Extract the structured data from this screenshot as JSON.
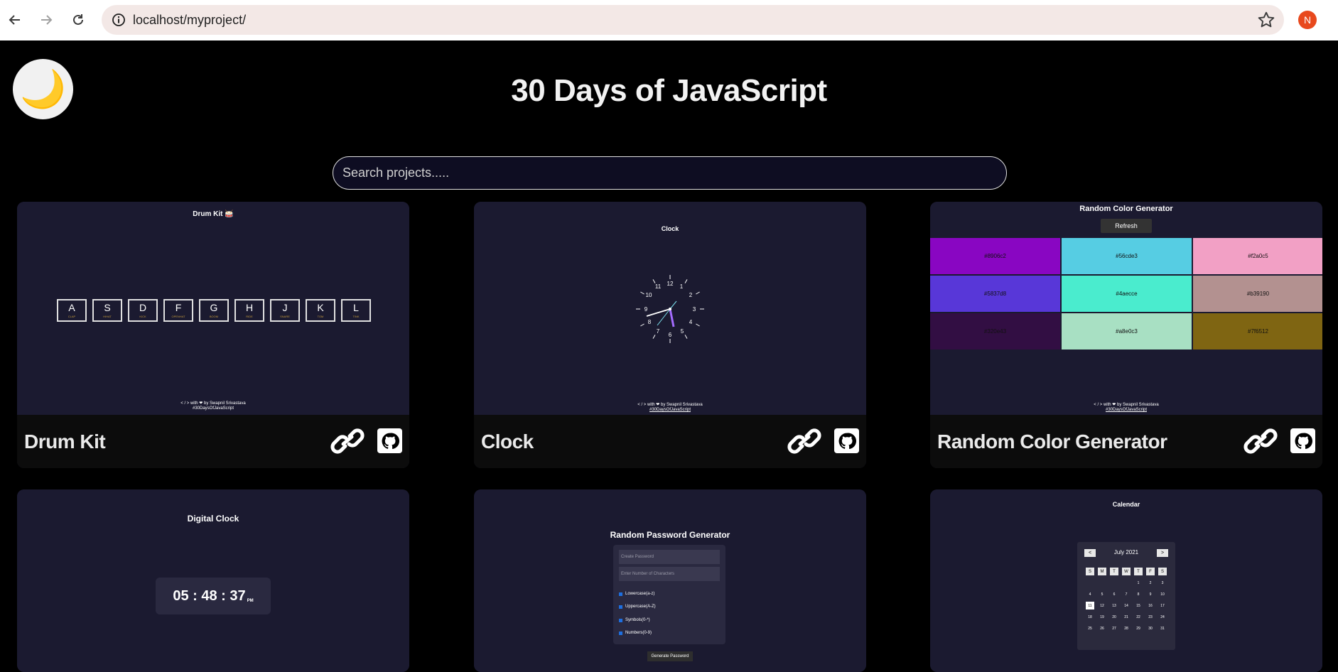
{
  "browser": {
    "url": "localhost/myproject/",
    "profile_initial": "N"
  },
  "page": {
    "title": "30 Days of JavaScript",
    "search_placeholder": "Search projects.....",
    "theme_icon": "🌙"
  },
  "cards": [
    {
      "title": "Drum Kit",
      "preview": {
        "heading": "Drum Kit 🥁",
        "keys": [
          {
            "key": "A",
            "sound": "CLAP"
          },
          {
            "key": "S",
            "sound": "HIHAT"
          },
          {
            "key": "D",
            "sound": "KICK"
          },
          {
            "key": "F",
            "sound": "OPENHAT"
          },
          {
            "key": "G",
            "sound": "BOOM"
          },
          {
            "key": "H",
            "sound": "RIDE"
          },
          {
            "key": "J",
            "sound": "SNARE"
          },
          {
            "key": "K",
            "sound": "TOM"
          },
          {
            "key": "L",
            "sound": "TINK"
          }
        ],
        "credit_line1": "< / > with ❤ by Swapnil Srivastava",
        "credit_line2": "#30DaysOfJavaScript"
      }
    },
    {
      "title": "Clock",
      "preview": {
        "heading": "Clock",
        "numbers": [
          "12",
          "1",
          "2",
          "3",
          "4",
          "5",
          "6",
          "7",
          "8",
          "9",
          "10",
          "11"
        ],
        "credit_line1": "< / > with ❤ by Swapnil Srivastava",
        "credit_line2": "#30DaysOfJavaScript"
      }
    },
    {
      "title": "Random Color Generator",
      "preview": {
        "heading": "Random Color Generator",
        "refresh_label": "Refresh",
        "colors": [
          "#8906c2",
          "#56cde3",
          "#f2a0c5",
          "#5837d8",
          "#4aecce",
          "#b39190",
          "#320e43",
          "#a8e0c3",
          "#7f6512"
        ],
        "color_labels": [
          "#8906c2",
          "#56cde3",
          "#f2a0c5",
          "#5837d8",
          "#4aecce",
          "#b39190",
          "#320e43",
          "#a8e0c3",
          "#7f6512"
        ],
        "credit_line1": "< / > with ❤ by Swapnil Srivastava",
        "credit_line2": "#30DaysOfJavaScript"
      }
    },
    {
      "title": "Digital Clock",
      "preview": {
        "heading": "Digital Clock",
        "hours": "05",
        "minutes": "48",
        "seconds": "37",
        "period": "PM"
      }
    },
    {
      "title": "Random Password Generator",
      "preview": {
        "heading": "Random Password Generator",
        "field1_placeholder": "Create Password",
        "field2_placeholder": "Enter Number of Characters",
        "options": [
          "Lowercase(a-z)",
          "Uppercase(A-Z)",
          "Symbols(0-*)",
          "Numbers(0-9)"
        ],
        "button_label": "Generate Password"
      }
    },
    {
      "title": "Calendar",
      "preview": {
        "heading": "Calendar",
        "prev_label": "<",
        "next_label": ">",
        "month_label": "July 2021",
        "weekdays": [
          "S",
          "M",
          "T",
          "W",
          "T",
          "F",
          "S"
        ],
        "days": [
          "",
          "",
          "",
          "",
          "1",
          "2",
          "3",
          "4",
          "5",
          "6",
          "7",
          "8",
          "9",
          "10",
          "11",
          "12",
          "13",
          "14",
          "15",
          "16",
          "17",
          "18",
          "19",
          "20",
          "21",
          "22",
          "23",
          "24",
          "25",
          "26",
          "27",
          "28",
          "29",
          "30",
          "31"
        ],
        "today": "11"
      }
    }
  ],
  "colors": {
    "background": "#000000",
    "card_bg": "#1b1a30",
    "card_footer": "#0c0c0c"
  }
}
